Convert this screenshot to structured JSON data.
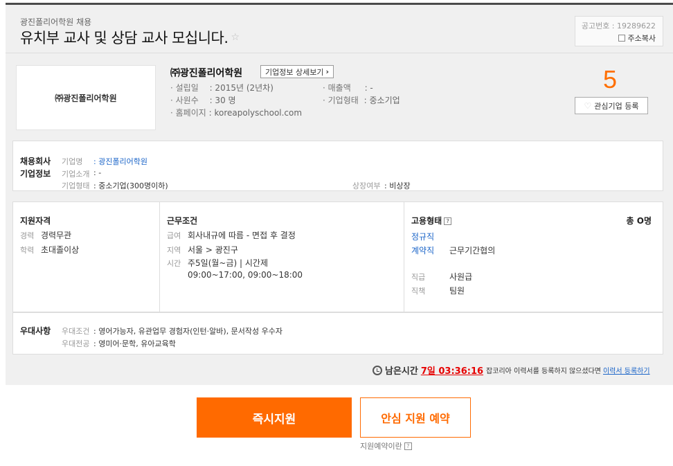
{
  "header": {
    "company_hiring": "광진폴리어학원 채용",
    "title": "유치부 교사 및 상담 교사 모십니다.",
    "notice_number": "공고번호 : 19289622",
    "copy_address": "주소복사"
  },
  "company": {
    "logo_text": "㈜광진폴리어학원",
    "name": "㈜광진폴리어학원",
    "detail_button": "기업정보 상세보기",
    "founded_label": "· 설립일",
    "founded_value": ": 2015년 (2년차)",
    "revenue_label": "· 매출액",
    "revenue_value": ": -",
    "employees_label": "· 사원수",
    "employees_value": ": 30 명",
    "type_label": "· 기업형태",
    "type_value": ": 중소기업",
    "homepage_label": "· 홈페이지",
    "homepage_value": ": koreapolyschool.com",
    "interest_count": "5",
    "interest_button": "관심기업 등록"
  },
  "company_info": {
    "heading_line1": "채용회사",
    "heading_line2": "기업정보",
    "name_label": "기업명",
    "name_value": ": 광진폴리어학원",
    "intro_label": "기업소개",
    "intro_value": ": -",
    "type_label": "기업형태",
    "type_value": ": 중소기업(300명이하)",
    "listing_label": "상장여부",
    "listing_value": ": 비상장"
  },
  "qualification": {
    "heading": "지원자격",
    "career_label": "경력",
    "career_value": "경력무관",
    "education_label": "학력",
    "education_value": "초대졸이상"
  },
  "conditions": {
    "heading": "근무조건",
    "salary_label": "급여",
    "salary_value": "회사내규에 따름 - 면접 후 결정",
    "location_label": "지역",
    "location_value": "서울 > 광진구",
    "time_label": "시간",
    "time_value": "주5일(월~금) | 시간제",
    "time_detail": "09:00~17:00, 09:00~18:00"
  },
  "employment": {
    "heading": "고용형태",
    "help": "?",
    "total": "총 O명",
    "type1": "정규직",
    "type2": "계약직",
    "type2_note": "근무기간협의",
    "rank_label": "직급",
    "rank_value": "사원급",
    "position_label": "직책",
    "position_value": "팀원"
  },
  "preference": {
    "heading": "우대사항",
    "cond_label": "우대조건",
    "cond_value": ": 영어가능자, 유관업무 경험자(인턴·알바), 문서작성 우수자",
    "major_label": "우대전공",
    "major_value": ": 영미어·문학, 유아교육학"
  },
  "timer": {
    "label": "남은시간",
    "value": "7일 03:36:16",
    "note": "잡코리아 이력서를 등록하지 않으셨다면",
    "link": "이력서 등록하기"
  },
  "actions": {
    "apply": "즉시지원",
    "reserve": "안심 지원 예약",
    "reserve_help": "지원예약이란"
  }
}
